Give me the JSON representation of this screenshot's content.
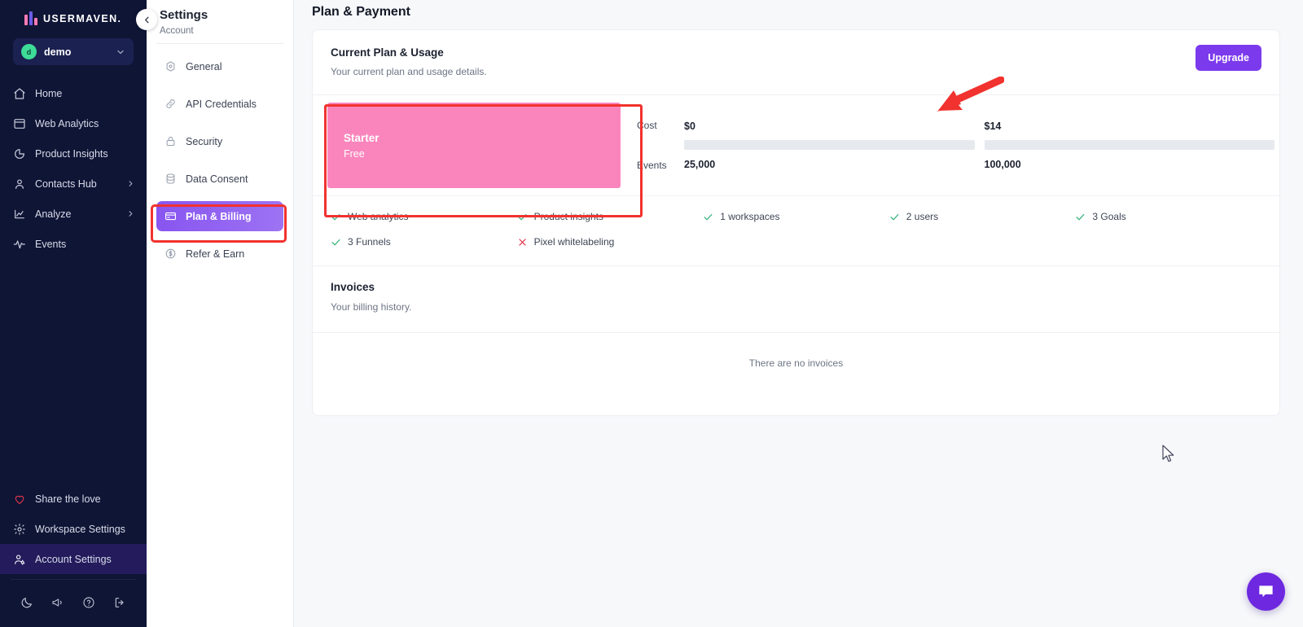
{
  "brand": {
    "name": "USERMAVEN."
  },
  "workspace": {
    "name": "demo",
    "avatar_letter": "d",
    "chevron_icon": "chevron-down-icon"
  },
  "leftnav": {
    "items": [
      {
        "label": "Home",
        "icon": "home-icon",
        "expandable": false,
        "active": false
      },
      {
        "label": "Web Analytics",
        "icon": "window-icon",
        "expandable": false,
        "active": false
      },
      {
        "label": "Product Insights",
        "icon": "pie-chart-icon",
        "expandable": false,
        "active": false
      },
      {
        "label": "Contacts Hub",
        "icon": "user-icon",
        "expandable": true,
        "active": false
      },
      {
        "label": "Analyze",
        "icon": "chart-icon",
        "expandable": true,
        "active": false
      },
      {
        "label": "Events",
        "icon": "pulse-icon",
        "expandable": false,
        "active": false
      }
    ],
    "bottom_items": [
      {
        "label": "Share the love",
        "icon": "heart-icon",
        "active": false
      },
      {
        "label": "Workspace Settings",
        "icon": "gear-icon",
        "active": false
      },
      {
        "label": "Account Settings",
        "icon": "user-gear-icon",
        "active": true
      }
    ],
    "footer_icons": [
      {
        "name": "moon-icon"
      },
      {
        "name": "megaphone-icon"
      },
      {
        "name": "help-circle-icon"
      },
      {
        "name": "logout-icon"
      }
    ]
  },
  "settings": {
    "title": "Settings",
    "subtitle": "Account",
    "collapse_icon": "chevron-left-icon",
    "items": [
      {
        "label": "General",
        "icon": "hexagon-gear-icon",
        "active": false
      },
      {
        "label": "API Credentials",
        "icon": "link-icon",
        "active": false
      },
      {
        "label": "Security",
        "icon": "lock-icon",
        "active": false
      },
      {
        "label": "Data Consent",
        "icon": "database-icon",
        "active": false
      },
      {
        "label": "Plan & Billing",
        "icon": "credit-card-icon",
        "active": true
      },
      {
        "label": "Refer & Earn",
        "icon": "dollar-circle-icon",
        "active": false
      }
    ]
  },
  "main": {
    "page_title": "Plan & Payment",
    "plan_section": {
      "heading": "Current Plan & Usage",
      "description": "Your current plan and usage details.",
      "upgrade_label": "Upgrade",
      "plan_name": "Starter",
      "plan_price": "Free",
      "plan_color": "#fa85bc",
      "usage_row_labels": {
        "cost": "Cost",
        "events": "Events"
      },
      "usage_columns": [
        {
          "cost": "$0",
          "events": "25,000",
          "bar_fill_percent": 0
        },
        {
          "cost": "$14",
          "events": "100,000",
          "bar_fill_percent": 0
        }
      ],
      "features": [
        {
          "label": "Web analytics",
          "included": true
        },
        {
          "label": "Product insights",
          "included": true
        },
        {
          "label": "1 workspaces",
          "included": true
        },
        {
          "label": "2 users",
          "included": true
        },
        {
          "label": "3 Goals",
          "included": true
        },
        {
          "label": "3 Funnels",
          "included": true
        },
        {
          "label": "Pixel whitelabeling",
          "included": false
        }
      ]
    },
    "invoices_section": {
      "heading": "Invoices",
      "description": "Your billing history.",
      "empty_message": "There are no invoices"
    }
  },
  "annotations": {
    "arrow_color": "#f1322e",
    "highlight_color": "#f1322e"
  },
  "chat": {
    "icon": "chat-bubble-icon",
    "color": "#6d28e0"
  }
}
